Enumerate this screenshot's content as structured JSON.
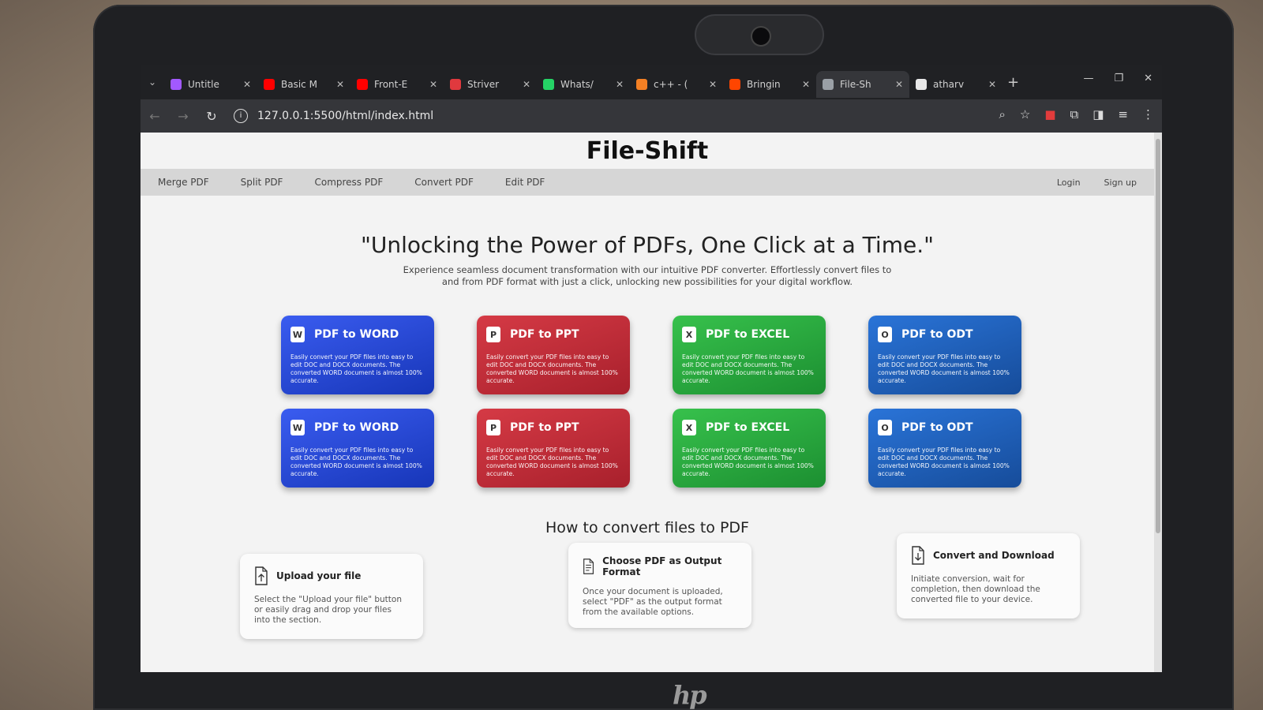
{
  "browser": {
    "tabs": [
      {
        "title": "Untitle",
        "favicon_color": "#a259ff",
        "favicon": "figma-icon",
        "active": false
      },
      {
        "title": "Basic M",
        "favicon_color": "#ff0000",
        "favicon": "youtube-icon",
        "active": false
      },
      {
        "title": "Front-E",
        "favicon_color": "#ff0000",
        "favicon": "youtube-icon",
        "active": false
      },
      {
        "title": "Striver",
        "favicon_color": "#e0393e",
        "favicon": "striver-icon",
        "active": false
      },
      {
        "title": "Whats/",
        "favicon_color": "#25d366",
        "favicon": "whatsapp-icon",
        "active": false
      },
      {
        "title": "c++ - (",
        "favicon_color": "#f48024",
        "favicon": "stackoverflow-icon",
        "active": false
      },
      {
        "title": "Bringin",
        "favicon_color": "#ff4500",
        "favicon": "reddit-icon",
        "active": false
      },
      {
        "title": "File-Sh",
        "favicon_color": "#9aa0a6",
        "favicon": "globe-icon",
        "active": true
      },
      {
        "title": "atharv",
        "favicon_color": "#e8e8e8",
        "favicon": "github-icon",
        "active": false
      }
    ],
    "url": "127.0.0.1:5500/html/index.html"
  },
  "site": {
    "title": "File-Shift",
    "nav": [
      "Merge PDF",
      "Split PDF",
      "Compress PDF",
      "Convert PDF",
      "Edit PDF"
    ],
    "auth": {
      "login": "Login",
      "signup": "Sign up"
    }
  },
  "hero": {
    "quote": "\"Unlocking the Power of PDFs, One Click at a Time.\"",
    "subtitle": "Experience seamless document transformation with our intuitive PDF converter. Effortlessly convert files to and from PDF format with just a click, unlocking new possibilities for your digital workflow."
  },
  "cards": [
    {
      "title": "PDF to WORD",
      "icon": "W",
      "color": "blue",
      "desc": "Easily convert your PDF files into easy to edit DOC and DOCX documents. The converted WORD document is almost 100% accurate."
    },
    {
      "title": "PDF to PPT",
      "icon": "P",
      "color": "red",
      "desc": "Easily convert your PDF files into easy to edit DOC and DOCX documents. The converted WORD document is almost 100% accurate."
    },
    {
      "title": "PDF to EXCEL",
      "icon": "X",
      "color": "green",
      "desc": "Easily convert your PDF files into easy to edit DOC and DOCX documents. The converted WORD document is almost 100% accurate."
    },
    {
      "title": "PDF to ODT",
      "icon": "O",
      "color": "navy",
      "desc": "Easily convert your PDF files into easy to edit DOC and DOCX documents. The converted WORD document is almost 100% accurate."
    },
    {
      "title": "PDF to WORD",
      "icon": "W",
      "color": "blue",
      "desc": "Easily convert your PDF files into easy to edit DOC and DOCX documents. The converted WORD document is almost 100% accurate."
    },
    {
      "title": "PDF to PPT",
      "icon": "P",
      "color": "red",
      "desc": "Easily convert your PDF files into easy to edit DOC and DOCX documents. The converted WORD document is almost 100% accurate."
    },
    {
      "title": "PDF to EXCEL",
      "icon": "X",
      "color": "green",
      "desc": "Easily convert your PDF files into easy to edit DOC and DOCX documents. The converted WORD document is almost 100% accurate."
    },
    {
      "title": "PDF to ODT",
      "icon": "O",
      "color": "navy",
      "desc": "Easily convert your PDF files into easy to edit DOC and DOCX documents. The converted WORD document is almost 100% accurate."
    }
  ],
  "how": {
    "title": "How to convert files to PDF",
    "steps": [
      {
        "title": "Upload your file",
        "icon": "upload-file-icon",
        "desc": "Select the \"Upload your file\" button or easily drag and drop your files into the section."
      },
      {
        "title": "Choose PDF as Output Format",
        "icon": "copy-files-icon",
        "desc": "Once your document is uploaded, select \"PDF\" as the output format from the available options."
      },
      {
        "title": "Convert and Download",
        "icon": "download-file-icon",
        "desc": "Initiate conversion, wait for completion, then download the converted file to your device."
      }
    ]
  },
  "device": {
    "brand": "hp"
  }
}
